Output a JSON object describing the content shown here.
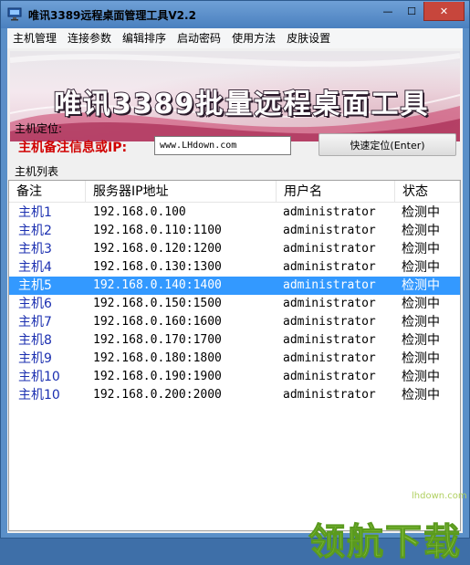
{
  "window": {
    "title": "唯讯3389远程桌面管理工具V2.2",
    "controls": {
      "minimize": "—",
      "maximize": "☐",
      "close": "✕"
    }
  },
  "menu": {
    "items": [
      "主机管理",
      "连接参数",
      "编辑排序",
      "启动密码",
      "使用方法",
      "皮肤设置"
    ]
  },
  "banner": {
    "title": "唯讯3389批量远程桌面工具"
  },
  "locate": {
    "group_label": "主机定位:",
    "field_label": "主机备注信息或IP:",
    "input_value": "www.LHdown.com",
    "button_label": "快速定位(Enter)"
  },
  "host_list": {
    "group_label": "主机列表",
    "columns": [
      "备注",
      "服务器IP地址",
      "用户名",
      "状态"
    ],
    "selected_index": 4,
    "rows": [
      {
        "name": "主机1",
        "ip": "192.168.0.100",
        "user": "administrator",
        "status": "检测中"
      },
      {
        "name": "主机2",
        "ip": "192.168.0.110:1100",
        "user": "administrator",
        "status": "检测中"
      },
      {
        "name": "主机3",
        "ip": "192.168.0.120:1200",
        "user": "administrator",
        "status": "检测中"
      },
      {
        "name": "主机4",
        "ip": "192.168.0.130:1300",
        "user": "administrator",
        "status": "检测中"
      },
      {
        "name": "主机5",
        "ip": "192.168.0.140:1400",
        "user": "administrator",
        "status": "检测中"
      },
      {
        "name": "主机6",
        "ip": "192.168.0.150:1500",
        "user": "administrator",
        "status": "检测中"
      },
      {
        "name": "主机7",
        "ip": "192.168.0.160:1600",
        "user": "administrator",
        "status": "检测中"
      },
      {
        "name": "主机8",
        "ip": "192.168.0.170:1700",
        "user": "administrator",
        "status": "检测中"
      },
      {
        "name": "主机9",
        "ip": "192.168.0.180:1800",
        "user": "administrator",
        "status": "检测中"
      },
      {
        "name": "主机10",
        "ip": "192.168.0.190:1900",
        "user": "administrator",
        "status": "检测中"
      },
      {
        "name": "主机10",
        "ip": "192.168.0.200:2000",
        "user": "administrator",
        "status": "检测中"
      }
    ]
  },
  "watermark": {
    "text": "领航下载",
    "url": "lhdown.com"
  },
  "colors": {
    "accent_selection": "#3399ff",
    "host_name": "#1b2fb0",
    "label_red": "#d00000",
    "window_frame": "#5a8fc8",
    "close_button": "#c7463c"
  }
}
